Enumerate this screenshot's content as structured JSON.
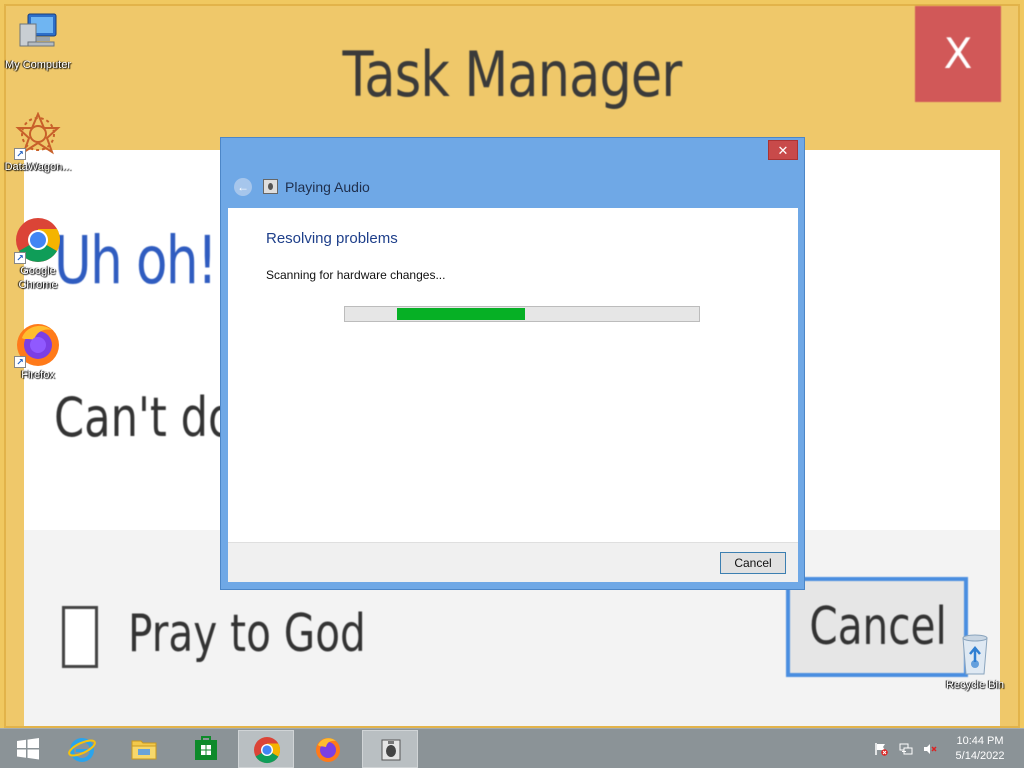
{
  "wallpaper": {
    "title": "Task Manager",
    "close_label": "X",
    "headline": "Uh oh!",
    "message": "Can't do tha",
    "checkbox_label": "Pray to God",
    "cancel_label": "Cancel"
  },
  "desktop": {
    "icons": [
      {
        "label": "My Computer",
        "icon": "computer-icon"
      },
      {
        "label": "DataWagon...",
        "icon": "datawagon-icon"
      },
      {
        "label": "Google Chrome",
        "icon": "chrome-icon"
      },
      {
        "label": "Firefox",
        "icon": "firefox-icon"
      },
      {
        "label": "Recycle Bin",
        "icon": "recycle-bin-icon"
      }
    ]
  },
  "dialog": {
    "title": "Playing Audio",
    "close_label": "✕",
    "back_label": "←",
    "heading": "Resolving problems",
    "status": "Scanning for hardware changes...",
    "progress_percent": 36,
    "cancel_label": "Cancel"
  },
  "taskbar": {
    "items": [
      "start-icon",
      "internet-explorer-icon",
      "file-explorer-icon",
      "store-icon",
      "chrome-icon",
      "firefox-icon",
      "troubleshooter-icon"
    ],
    "active_item": "chrome-icon",
    "clock": {
      "time": "10:44 PM",
      "date": "5/14/2022"
    }
  },
  "colors": {
    "wallpaper_bg": "#f0c860",
    "dialog_frame": "#6fa8e6",
    "progress_fill": "#06b025",
    "taskbar_bg": "#8b9397"
  }
}
